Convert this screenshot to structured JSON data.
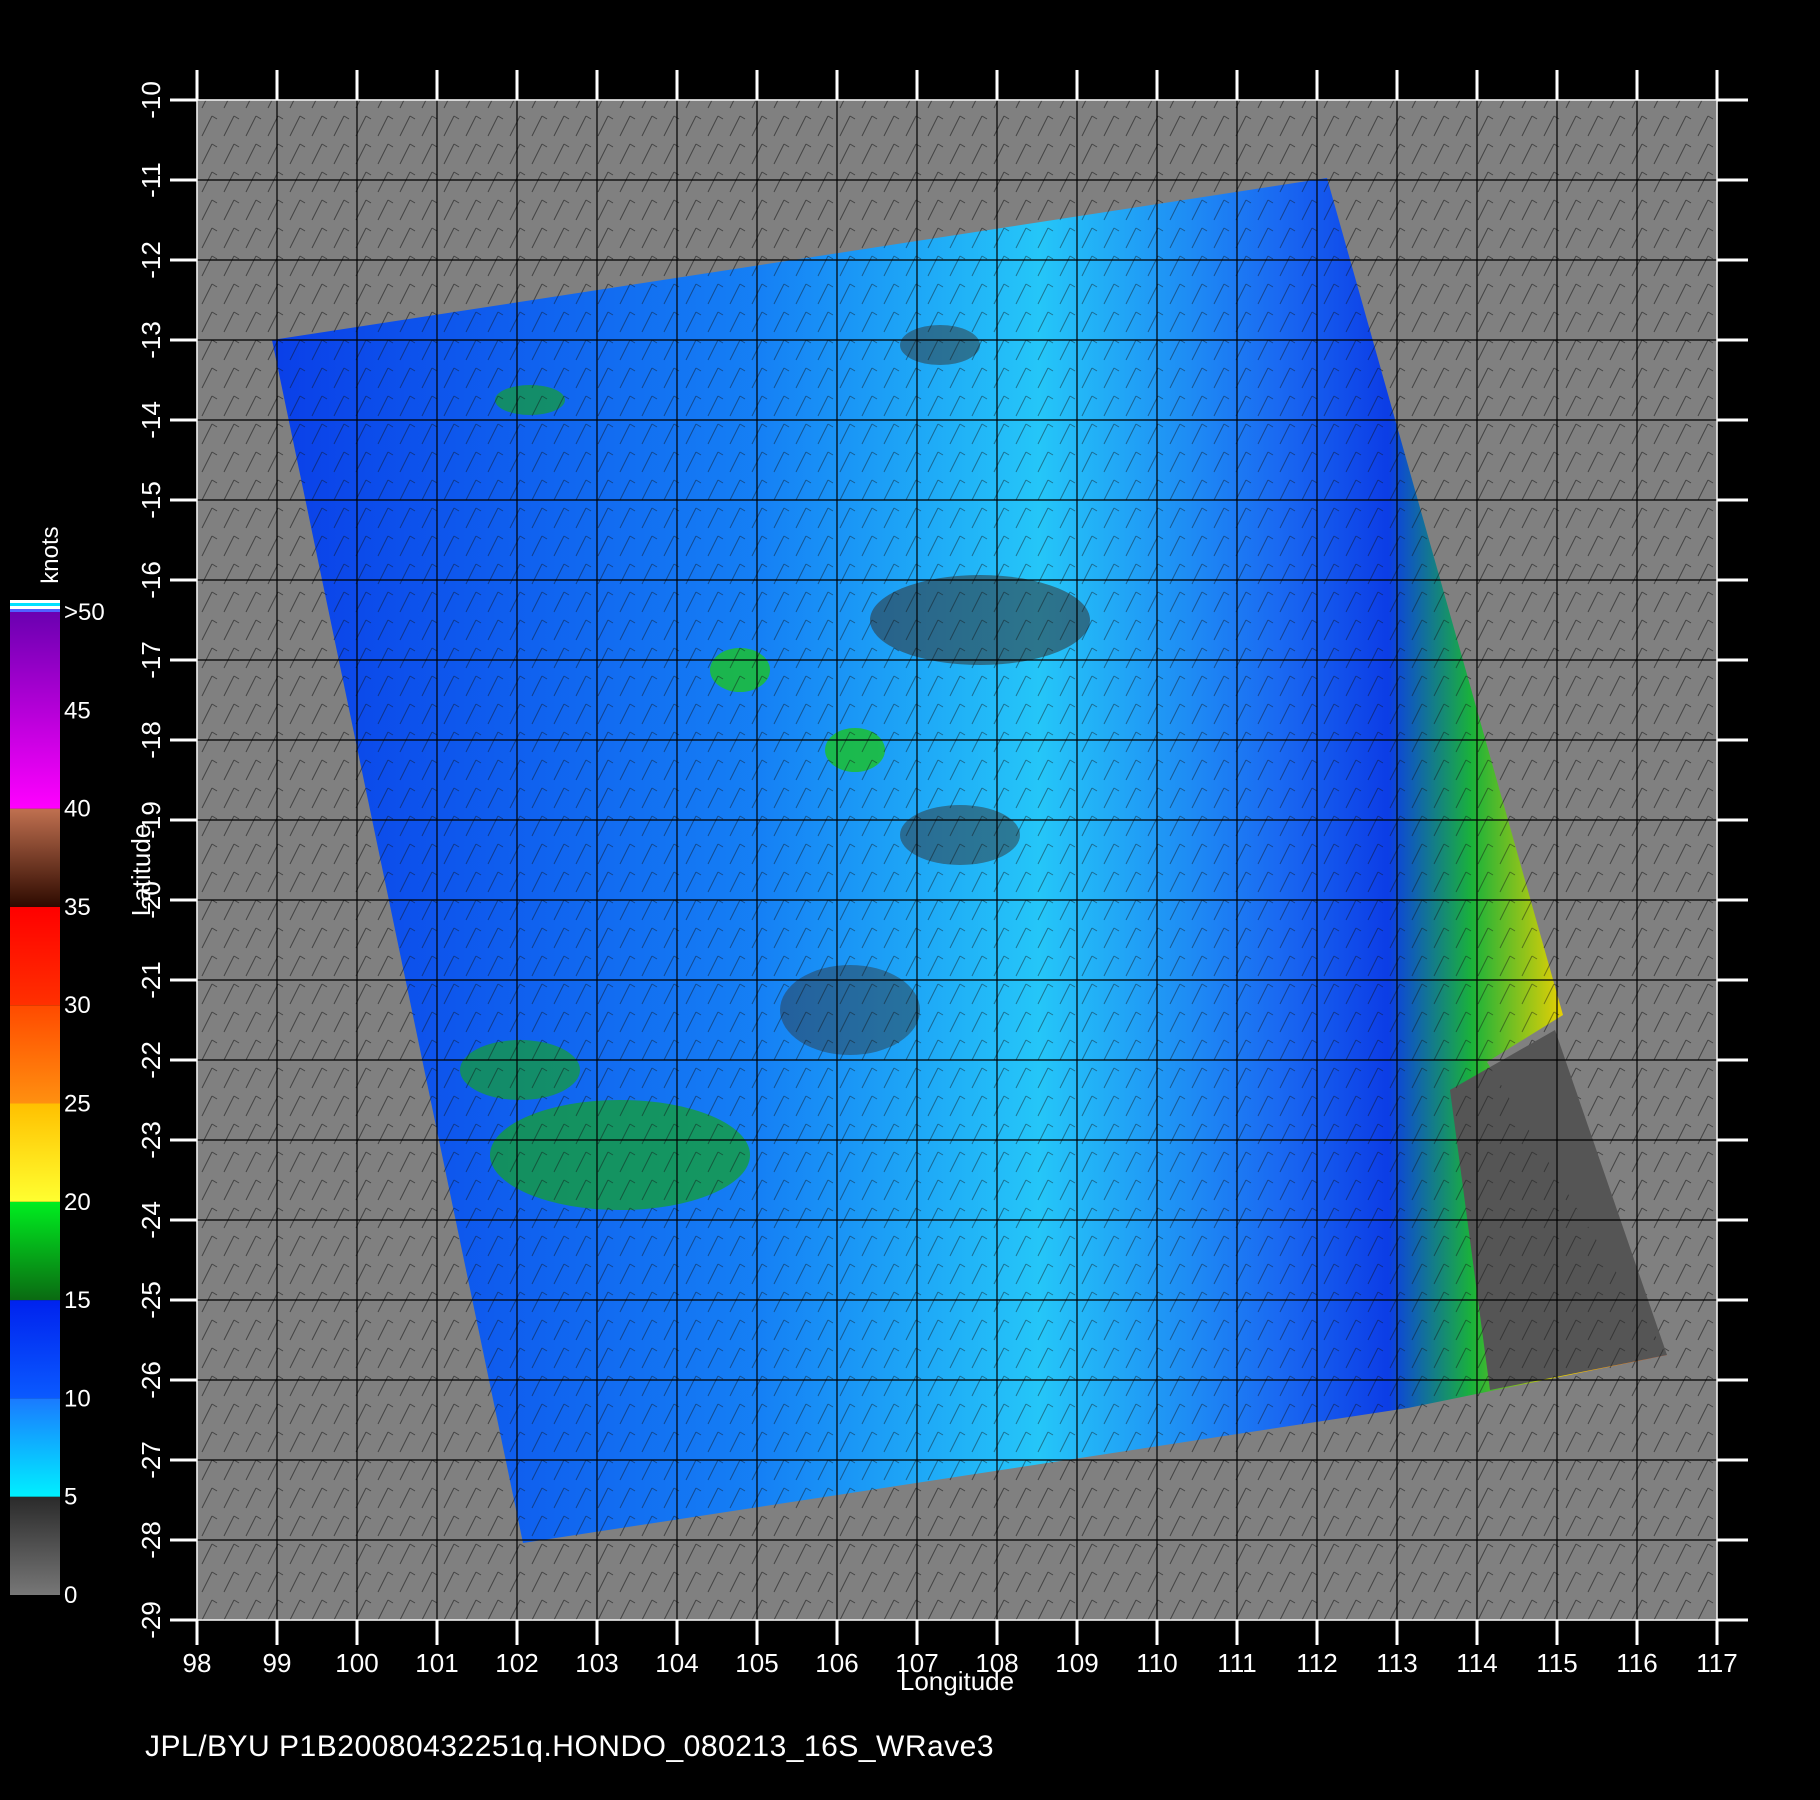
{
  "footer": "JPL/BYU  P1B20080432251q.HONDO_080213_16S_WRave3",
  "axes": {
    "x_title": "Longitude",
    "y_title": "Latitude",
    "lon_ticks": [
      "98",
      "99",
      "100",
      "101",
      "102",
      "103",
      "104",
      "105",
      "106",
      "107",
      "108",
      "109",
      "110",
      "111",
      "112",
      "113",
      "114",
      "115",
      "116",
      "117"
    ],
    "lat_ticks": [
      "-10",
      "-11",
      "-12",
      "-13",
      "-14",
      "-15",
      "-16",
      "-17",
      "-18",
      "-19",
      "-20",
      "-21",
      "-22",
      "-23",
      "-24",
      "-25",
      "-26",
      "-27",
      "-28",
      "-29"
    ]
  },
  "colorbar": {
    "unit": "knots",
    "labels": [
      ">50",
      "45",
      "40",
      "35",
      "30",
      "25",
      "20",
      "15",
      "10",
      "5",
      "0"
    ],
    "stops": [
      {
        "from": 0,
        "to": 5,
        "colors": [
          "#777777",
          "#2a2a2a"
        ]
      },
      {
        "from": 5,
        "to": 10,
        "colors": [
          "#00f0ff",
          "#1a7aff"
        ]
      },
      {
        "from": 10,
        "to": 15,
        "colors": [
          "#0a5aff",
          "#0022ee"
        ]
      },
      {
        "from": 15,
        "to": 20,
        "colors": [
          "#0a6a12",
          "#00ee20"
        ]
      },
      {
        "from": 20,
        "to": 25,
        "colors": [
          "#ffff30",
          "#ffc000"
        ]
      },
      {
        "from": 25,
        "to": 30,
        "colors": [
          "#ff9010",
          "#ff4a00"
        ]
      },
      {
        "from": 30,
        "to": 35,
        "colors": [
          "#ff3000",
          "#ff0000"
        ]
      },
      {
        "from": 35,
        "to": 40,
        "colors": [
          "#2e0a00",
          "#c07050"
        ]
      },
      {
        "from": 40,
        "to": 50,
        "colors": [
          "#ff00ff",
          "#6a00b0"
        ]
      }
    ]
  },
  "colors": {
    "background": "#000000",
    "land_gray": "#808080",
    "swath_base": "#1d6cf2",
    "grid": "#000000"
  }
}
